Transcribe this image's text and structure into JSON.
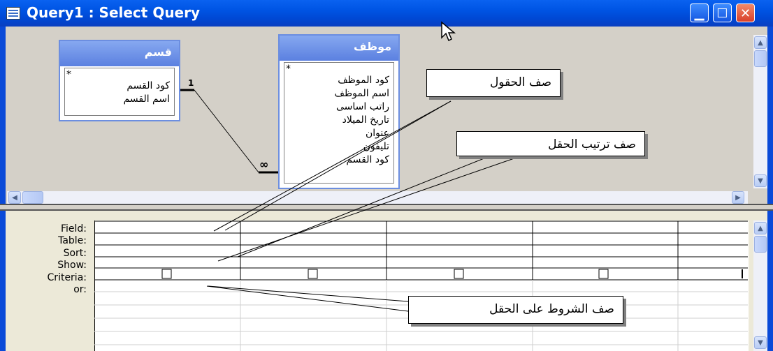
{
  "window": {
    "title": "Query1 : Select Query"
  },
  "tables": [
    {
      "name": "قسم",
      "fields": [
        "*",
        "كود القسم",
        "اسم القسم"
      ]
    },
    {
      "name": "موظف",
      "fields": [
        "*",
        "كود الموظف",
        "اسم الموظف",
        "راتب اساسى",
        "تاريخ الميلاد",
        "عنوان",
        "تليفون",
        "كود القسم"
      ]
    }
  ],
  "relationship": {
    "one_side": "1",
    "many_side": "∞"
  },
  "grid": {
    "row_labels": [
      "Field:",
      "Table:",
      "Sort:",
      "Show:",
      "Criteria:",
      "or:"
    ]
  },
  "callouts": {
    "fields_row": "صف الحقول",
    "sort_row": "صف ترتيب الحقل",
    "criteria_row": "صف الشروط على الحقل"
  },
  "colors": {
    "titlebar": "#0055E5",
    "table_header": "#6C8EE0",
    "workspace": "#D4D0C8"
  }
}
